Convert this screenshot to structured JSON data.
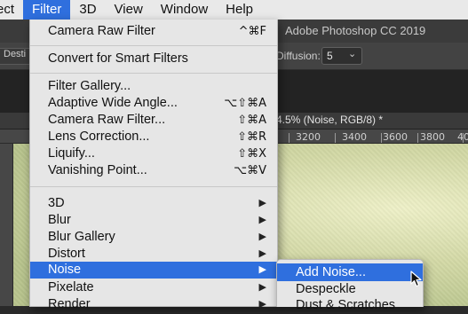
{
  "menubar": {
    "items": [
      "ect",
      "Filter",
      "3D",
      "View",
      "Window",
      "Help"
    ]
  },
  "app": {
    "title": "Adobe Photoshop CC 2019",
    "options": {
      "destination_label": "Desti",
      "diffusion_label": "Diffusion:",
      "diffusion_value": "5"
    },
    "doc_tab_title": "4.5% (Noise, RGB/8) *",
    "ruler_labels": [
      "3200",
      "3400",
      "3600",
      "3800",
      "40"
    ]
  },
  "filter_menu": {
    "camera_raw_filter": {
      "label": "Camera Raw Filter",
      "shortcut": "^⌘F"
    },
    "convert_smart": {
      "label": "Convert for Smart Filters"
    },
    "filter_gallery": {
      "label": "Filter Gallery..."
    },
    "adaptive_wide_angle": {
      "label": "Adaptive Wide Angle...",
      "shortcut": "⌥⇧⌘A"
    },
    "camera_raw_filter_dlg": {
      "label": "Camera Raw Filter...",
      "shortcut": "⇧⌘A"
    },
    "lens_correction": {
      "label": "Lens Correction...",
      "shortcut": "⇧⌘R"
    },
    "liquify": {
      "label": "Liquify...",
      "shortcut": "⇧⌘X"
    },
    "vanishing_point": {
      "label": "Vanishing Point...",
      "shortcut": "⌥⌘V"
    },
    "submenus": [
      "3D",
      "Blur",
      "Blur Gallery",
      "Distort",
      "Noise",
      "Pixelate",
      "Render"
    ],
    "highlighted": "Noise"
  },
  "noise_submenu": {
    "items": [
      "Add Noise...",
      "Despeckle",
      "Dust & Scratches"
    ],
    "highlighted": "Add Noise..."
  },
  "colors": {
    "highlight": "#2f6fde",
    "menu_bg": "#e6e6e6"
  }
}
